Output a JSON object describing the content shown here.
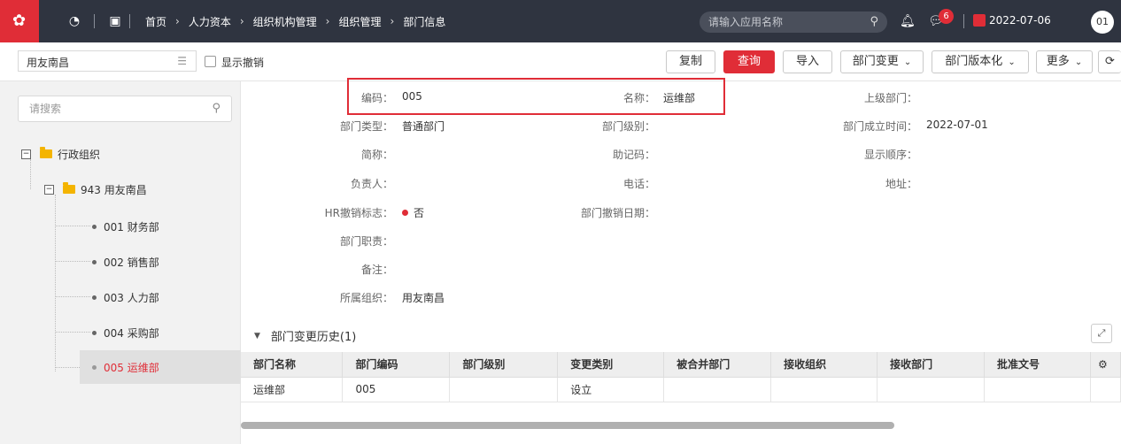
{
  "topbar": {
    "breadcrumb": [
      "首页",
      "人力资本",
      "组织机构管理",
      "组织管理",
      "部门信息"
    ],
    "app_search_placeholder": "请输入应用名称",
    "message_count": "6",
    "date": "2022-07-06",
    "avatar": "01"
  },
  "toolbar": {
    "org_value": "用友南昌",
    "show_revoked_label": "显示撤销",
    "buttons": {
      "copy": "复制",
      "query": "查询",
      "import": "导入",
      "dept_change": "部门变更",
      "dept_version": "部门版本化",
      "more": "更多"
    }
  },
  "tree": {
    "search_placeholder": "请搜索",
    "root": "行政组织",
    "org": "943 用友南昌",
    "depts": [
      "001 财务部",
      "002 销售部",
      "003 人力部",
      "004 采购部",
      "005 运维部"
    ]
  },
  "detail": {
    "code_label": "编码：",
    "code_value": "005",
    "name_label": "名称：",
    "name_value": "运维部",
    "parent_label": "上级部门：",
    "type_label": "部门类型：",
    "type_value": "普通部门",
    "level_label": "部门级别：",
    "founded_label": "部门成立时间：",
    "founded_value": "2022-07-01",
    "short_label": "简称：",
    "mnemonic_label": "助记码：",
    "order_label": "显示顺序：",
    "head_label": "负责人：",
    "phone_label": "电话：",
    "address_label": "地址：",
    "hr_revoke_label": "HR撤销标志：",
    "hr_revoke_value": "否",
    "revoke_date_label": "部门撤销日期：",
    "duty_label": "部门职责：",
    "remark_label": "备注：",
    "org_label": "所属组织：",
    "org_value": "用友南昌"
  },
  "history": {
    "title": "部门变更历史(1)",
    "columns": [
      "部门名称",
      "部门编码",
      "部门级别",
      "变更类别",
      "被合并部门",
      "接收组织",
      "接收部门",
      "批准文号"
    ],
    "rows": [
      [
        "运维部",
        "005",
        "",
        "设立",
        "",
        "",
        "",
        ""
      ]
    ]
  },
  "colors": {
    "brand": "#e02d37",
    "topbar": "#2f3440"
  }
}
